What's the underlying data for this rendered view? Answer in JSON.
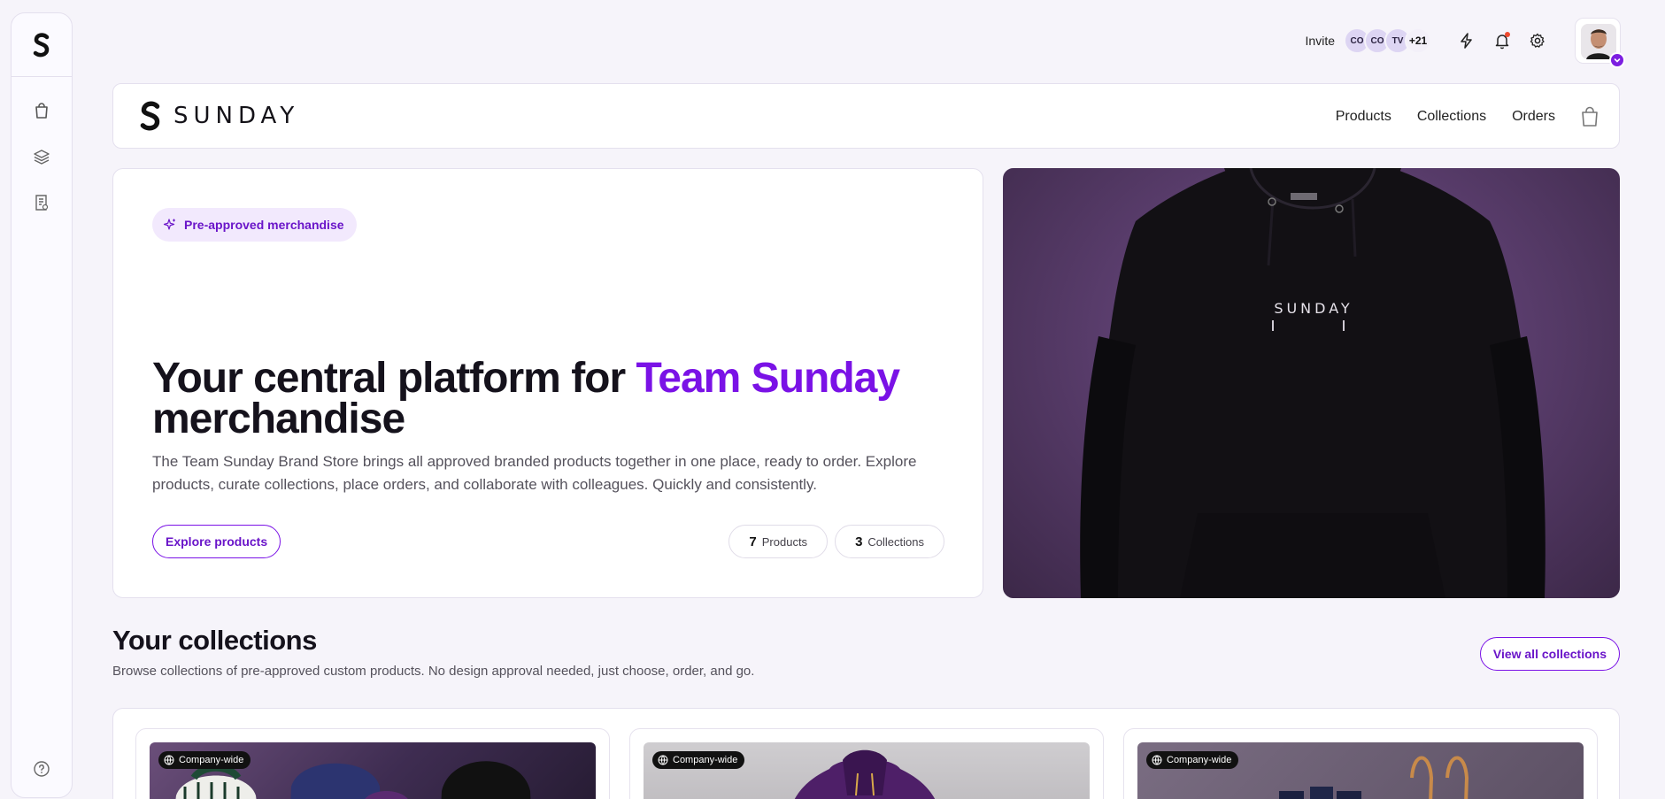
{
  "topbar": {
    "invite_label": "Invite",
    "members": [
      "CO",
      "CO",
      "TV"
    ],
    "more_count": "+21"
  },
  "store": {
    "brand_name": "SUNDAY",
    "nav": [
      "Products",
      "Collections",
      "Orders"
    ]
  },
  "hero": {
    "badge": "Pre-approved merchandise",
    "title_start": "Your central platform for ",
    "title_accent": "Team Sunday",
    "title_end": "merchandise",
    "description": "The Team Sunday Brand Store brings all approved branded products together in one place, ready to order. Explore products, curate collections, place orders, and collaborate with colleagues. Quickly and consistently.",
    "cta": "Explore products",
    "stats": [
      {
        "value": "7",
        "label": "Products"
      },
      {
        "value": "3",
        "label": "Collections"
      }
    ],
    "hoodie_print": "SUNDAY"
  },
  "collections": {
    "title": "Your collections",
    "subtitle": "Browse collections of pre-approved custom products. No design approval needed, just choose, order, and go.",
    "view_all": "View all collections",
    "cards": [
      {
        "tag": "Company-wide"
      },
      {
        "tag": "Company-wide"
      },
      {
        "tag": "Company-wide"
      }
    ]
  },
  "colors": {
    "accent": "#7a12e6",
    "background": "#f6f4fa",
    "notification": "#ef4a2f"
  },
  "icons": [
    "logo-icon",
    "shopping-bag-icon",
    "layers-icon",
    "receipt-icon",
    "help-icon",
    "lightning-icon",
    "bell-icon",
    "gear-icon",
    "cart-icon",
    "sparkle-icon",
    "globe-icon",
    "chevron-down-icon"
  ]
}
